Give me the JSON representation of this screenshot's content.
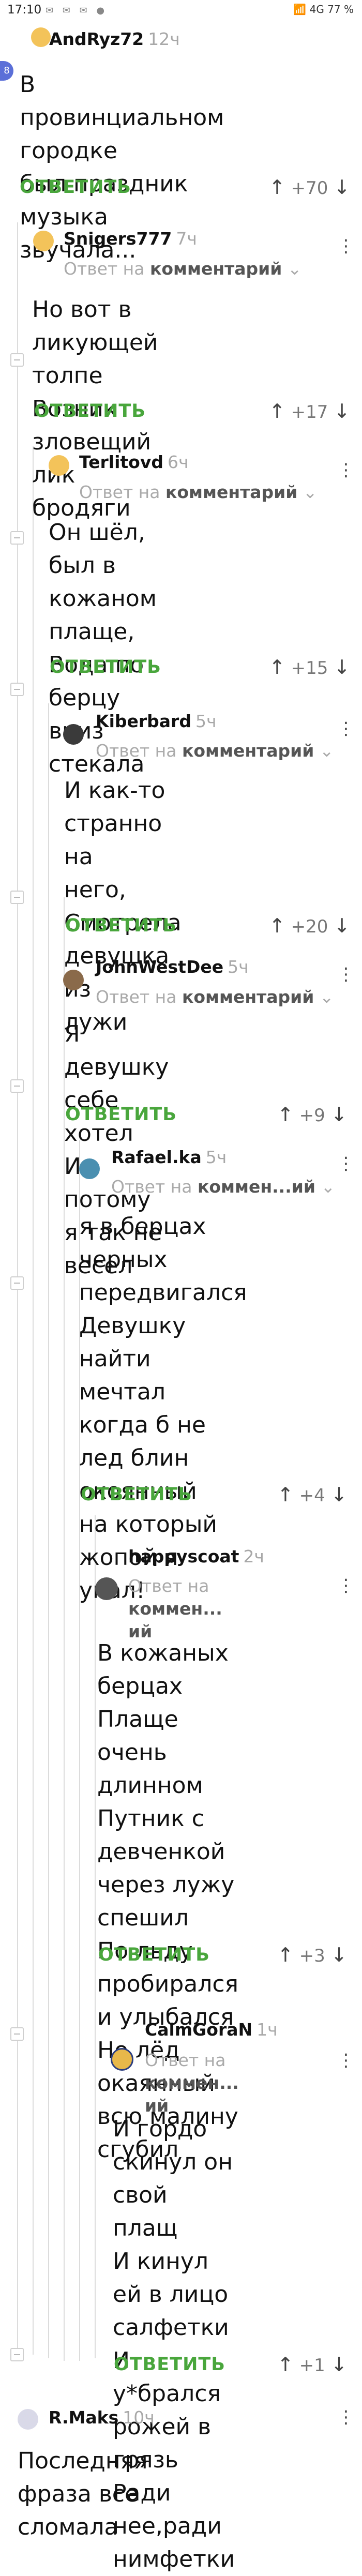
{
  "status_bar": {
    "time": "17:10",
    "left_icons": "✉ ✉ ✉ ●",
    "right_icons": "📶 4G 77 %"
  },
  "badge": "8",
  "comments": [
    {
      "username": "AndRyz72",
      "time": "12ч",
      "reply_prefix": "",
      "reply_link": "",
      "text": "В провинциальном городке\nбыл праздник музыка\nзвучала...",
      "reply_label": "ОТВЕТИТЬ",
      "votes": "+70"
    },
    {
      "username": "Snigers777",
      "time": "7ч",
      "reply_prefix": "Ответ на ",
      "reply_link": "комментарий",
      "text": "Но вот в ликующей толпе\nВозник зловещий лик\nбродяги",
      "reply_label": "ОТВЕТИТЬ",
      "votes": "+17"
    },
    {
      "username": "Terlitovd",
      "time": "6ч",
      "reply_prefix": "Ответ на ",
      "reply_link": "комментарий",
      "text": "Он шёл, был в кожаном\nплаще,\nВода по берцу вниз\nстекала",
      "reply_label": "ОТВЕТИТЬ",
      "votes": "+15"
    },
    {
      "username": "Kiberbard",
      "time": "5ч",
      "reply_prefix": "Ответ на ",
      "reply_link": "комментарий",
      "text": "И как-то странно на\nнего,\nСмотрела девушка из\nлужи",
      "reply_label": "ОТВЕТИТЬ",
      "votes": "+20"
    },
    {
      "username": "JohnWestDee",
      "time": "5ч",
      "reply_prefix": "Ответ на ",
      "reply_link": "комментарий",
      "text": "Я девушку себе хотел\nИ потому я так не весел",
      "reply_label": "ОТВЕТИТЬ",
      "votes": "+9"
    },
    {
      "username": "Rafael.ka",
      "time": "5ч",
      "reply_prefix": "Ответ на ",
      "reply_link": "коммен...ий",
      "text": "я в берцах черных\nпередвигался\nДевушку найти\nмечтал\nкогда б не лед блин\nокоянный\nна который жопой я\nупал!",
      "reply_label": "ОТВЕТИТЬ",
      "votes": "+4"
    },
    {
      "username": "happyscoat",
      "time": "2ч",
      "reply_prefix": "Ответ на ",
      "reply_link": "коммен...\nий",
      "text": "В кожаных берцах\nПлаще очень\nдлинном\nПутник с девченкой\nчерез лужу спешил\nПо льду пробирался\nи улыбался\nНо лёд окаянный\nвсю малину сгубил",
      "reply_label": "ОТВЕТИТЬ",
      "votes": "+3"
    },
    {
      "username": "CalmGoraN",
      "time": "1ч",
      "reply_prefix": "Ответ на ",
      "reply_link": "коммен...\nий",
      "text": "И гордо скинул он\nсвой плащ\nИ кинул ей в лицо\nсалфетки\nИ у*брался рожей в\nгрязь\nРади нее,ради\nнимфетки",
      "reply_label": "ОТВЕТИТЬ",
      "votes": "+1"
    },
    {
      "username": "R.Maks",
      "time": "10ч",
      "reply_prefix": "",
      "reply_link": "",
      "text": "Последняя фраза все\nсломала",
      "reply_label": "",
      "votes": ""
    }
  ],
  "colors": {
    "reply_green": "#49a63c",
    "thread_line": "#dcdcdc",
    "badge": "#5b6fd8"
  }
}
